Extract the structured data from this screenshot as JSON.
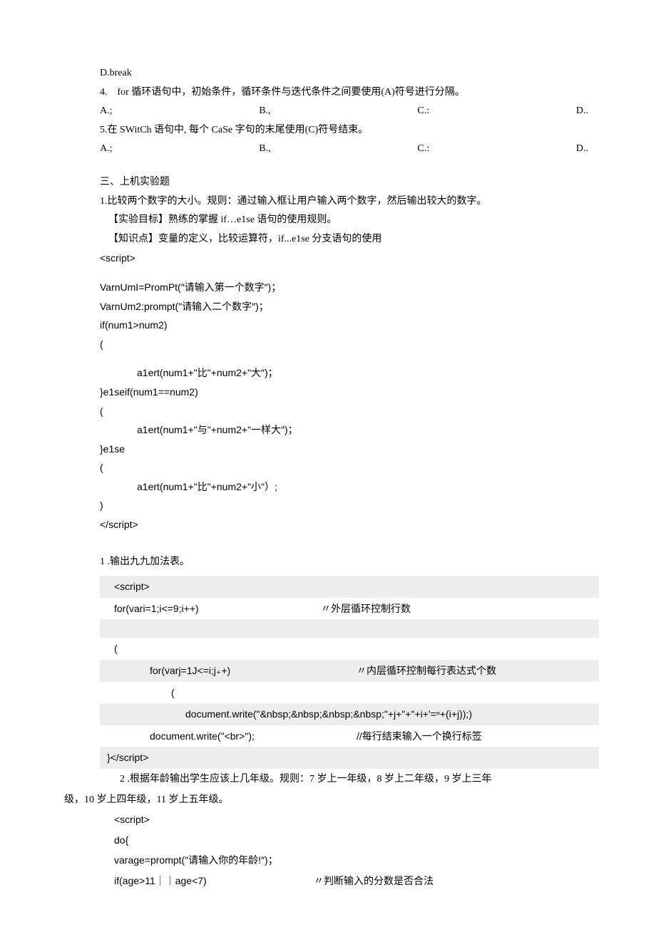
{
  "q3": {
    "optD": "D.break"
  },
  "q4": {
    "text": "4.　for 循环语句中，初始条件，循环条件与迭代条件之间要使用(A)符号进行分隔。",
    "opts": {
      "a": "A.;",
      "b": "B.,",
      "c": "C.:",
      "d": "D.."
    }
  },
  "q5": {
    "text": "5.在 SWitCh 语句中, 每个 CaSe 字句的末尾使用(C)符号结束。",
    "opts": {
      "a": "A.;",
      "b": "B.,",
      "c": "C.:",
      "d": "D.."
    }
  },
  "section3": {
    "title": "三、上机实验题",
    "p1": "1.比较两个数字的大小。规则：通过输入框让用户输入两个数字，然后输出较大的数字。",
    "goal": "【实验目标】熟练的掌握 if…e1se 语句的使用规则。",
    "know": "【知识点】变量的定义，比较运算符，if...e1se 分支语句的使用"
  },
  "code1": {
    "l1": "<script>",
    "l2": "VarnUmI=PromPt(″请输入第一个数字″)；",
    "l3": "VarnUm2:prompt(\"请输入二个数字″)；",
    "l4": "if(num1>num2)",
    "l5": "(",
    "l6": "a1ert(num1+\"比\"+num2+\"大″)；",
    "l7": "}e1seif(num1==num2)",
    "l8": "(",
    "l9": "a1ert(num1+\"与\"+num2+\"一样大″)；",
    "l10": "}e1se",
    "l11": "(",
    "l12": "a1ert(num1+\"比\"+num2+\"小\"）;",
    "l13": ")",
    "l14": "</script>"
  },
  "ex1": {
    "text": "1 .输出九九加法表。"
  },
  "code2": {
    "r1": "<script>",
    "r2a": "for(vari=1;i<=9;i++)",
    "r2b": "〃外层循环控制行数",
    "r3": "(",
    "r4a": "for(varj=1J<=i;j₊+)",
    "r4b": "〃内层循环控制每行表达式个数",
    "r5": "(",
    "r6": "document.write(\"&nbsp;&nbsp;&nbsp;&nbsp;\"+j+\"+\"+i+'=ⁿ+(i+j));)",
    "r7a": "document.write(\"<br>\");",
    "r7b": "//每行结束输入一个换行标签",
    "r8": "}</script>"
  },
  "ex2": {
    "p1": "2 .根据年龄输出学生应该上几年级。规则：7 岁上一年级，8 岁上二年级，9 岁上三年",
    "p2": "级，10 岁上四年级，11 岁上五年级。"
  },
  "code3": {
    "r1": "<script>",
    "r2": "do{",
    "r3": "varage=prompt(\"请输入你的年龄!″)；",
    "r4a": "if(age>11｜｜age<7)",
    "r4b": "〃判断输入的分数是否合法"
  }
}
